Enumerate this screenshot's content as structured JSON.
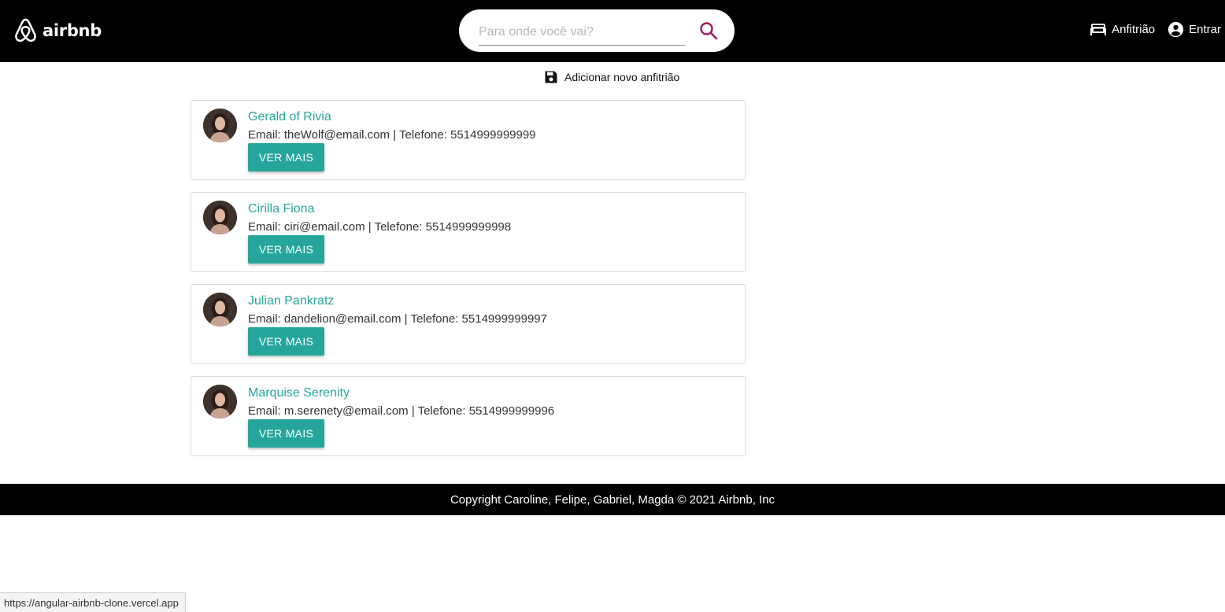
{
  "header": {
    "logo_text": "airbnb",
    "search": {
      "placeholder": "Para onde você vai?",
      "value": ""
    },
    "nav": {
      "host_label": "Anfitrião",
      "login_label": "Entrar"
    }
  },
  "toolbar": {
    "add_host_label": "Adicionar novo anfitrião"
  },
  "hosts": [
    {
      "name": "Gerald of Rivia",
      "email_label": "Email:",
      "email": "theWolf@email.com",
      "separator": "|",
      "phone_label": "Telefone:",
      "phone": "5514999999999",
      "button": "VER MAIS"
    },
    {
      "name": "Cirilla Fiona",
      "email_label": "Email:",
      "email": "ciri@email.com",
      "separator": "|",
      "phone_label": "Telefone:",
      "phone": "5514999999998",
      "button": "VER MAIS"
    },
    {
      "name": "Julian Pankratz",
      "email_label": "Email:",
      "email": "dandelion@email.com",
      "separator": "|",
      "phone_label": "Telefone:",
      "phone": "5514999999997",
      "button": "VER MAIS"
    },
    {
      "name": "Marquise Serenity",
      "email_label": "Email:",
      "email": "m.serenety@email.com",
      "separator": "|",
      "phone_label": "Telefone:",
      "phone": "5514999999996",
      "button": "VER MAIS"
    }
  ],
  "footer": {
    "copyright": "Copyright Caroline, Felipe, Gabriel, Magda © 2021 Airbnb, Inc"
  },
  "status_bar": {
    "url": "https://angular-airbnb-clone.vercel.app"
  },
  "colors": {
    "accent": "#26a69a",
    "search_icon": "#a0195a",
    "header_bg": "#000000"
  },
  "icons": {
    "logo": "airbnb-logo-icon",
    "search": "search-icon",
    "host": "bed-icon",
    "login": "account-circle-icon",
    "add": "save-icon"
  }
}
